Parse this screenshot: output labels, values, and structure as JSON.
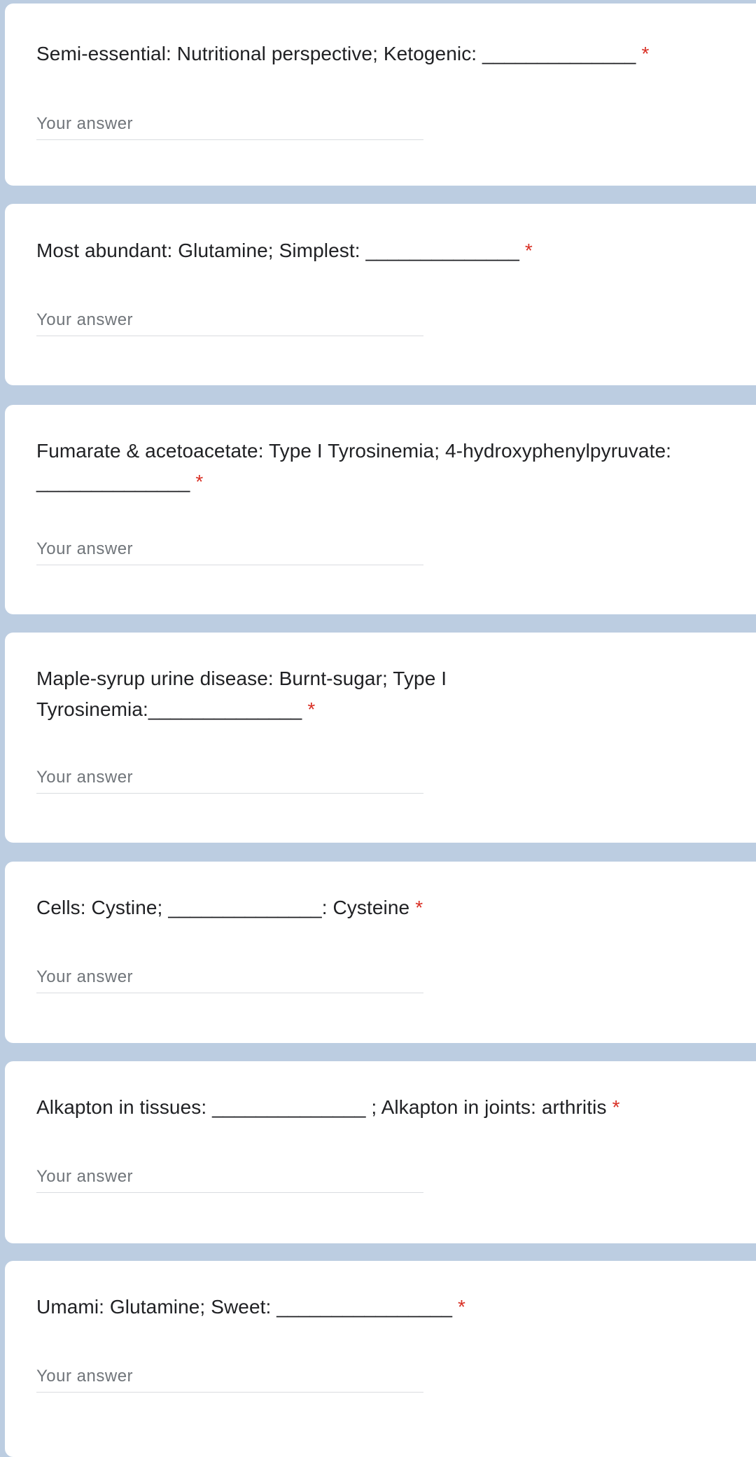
{
  "colors": {
    "background": "#bccde1",
    "card": "#ffffff",
    "text": "#202124",
    "required": "#d93025",
    "placeholder": "#70757a"
  },
  "required_marker": "*",
  "questions": [
    {
      "text": "Semi-essential: Nutritional perspective; Ketogenic: ______________",
      "answer_placeholder": "Your answer",
      "answer_value": ""
    },
    {
      "text": "Most abundant: Glutamine; Simplest: ______________",
      "answer_placeholder": "Your answer",
      "answer_value": ""
    },
    {
      "text": "Fumarate & acetoacetate: Type I Tyrosinemia; 4-hydroxyphenylpyruvate: ______________",
      "answer_placeholder": "Your answer",
      "answer_value": ""
    },
    {
      "text": "Maple-syrup urine disease: Burnt-sugar; Type I Tyrosinemia:______________",
      "answer_placeholder": "Your answer",
      "answer_value": ""
    },
    {
      "text": "Cells: Cystine; ______________: Cysteine",
      "answer_placeholder": "Your answer",
      "answer_value": ""
    },
    {
      "text": "Alkapton in tissues: ______________ ; Alkapton in joints: arthritis",
      "answer_placeholder": "Your answer",
      "answer_value": ""
    },
    {
      "text": "Umami: Glutamine; Sweet: ________________",
      "answer_placeholder": "Your answer",
      "answer_value": ""
    }
  ]
}
